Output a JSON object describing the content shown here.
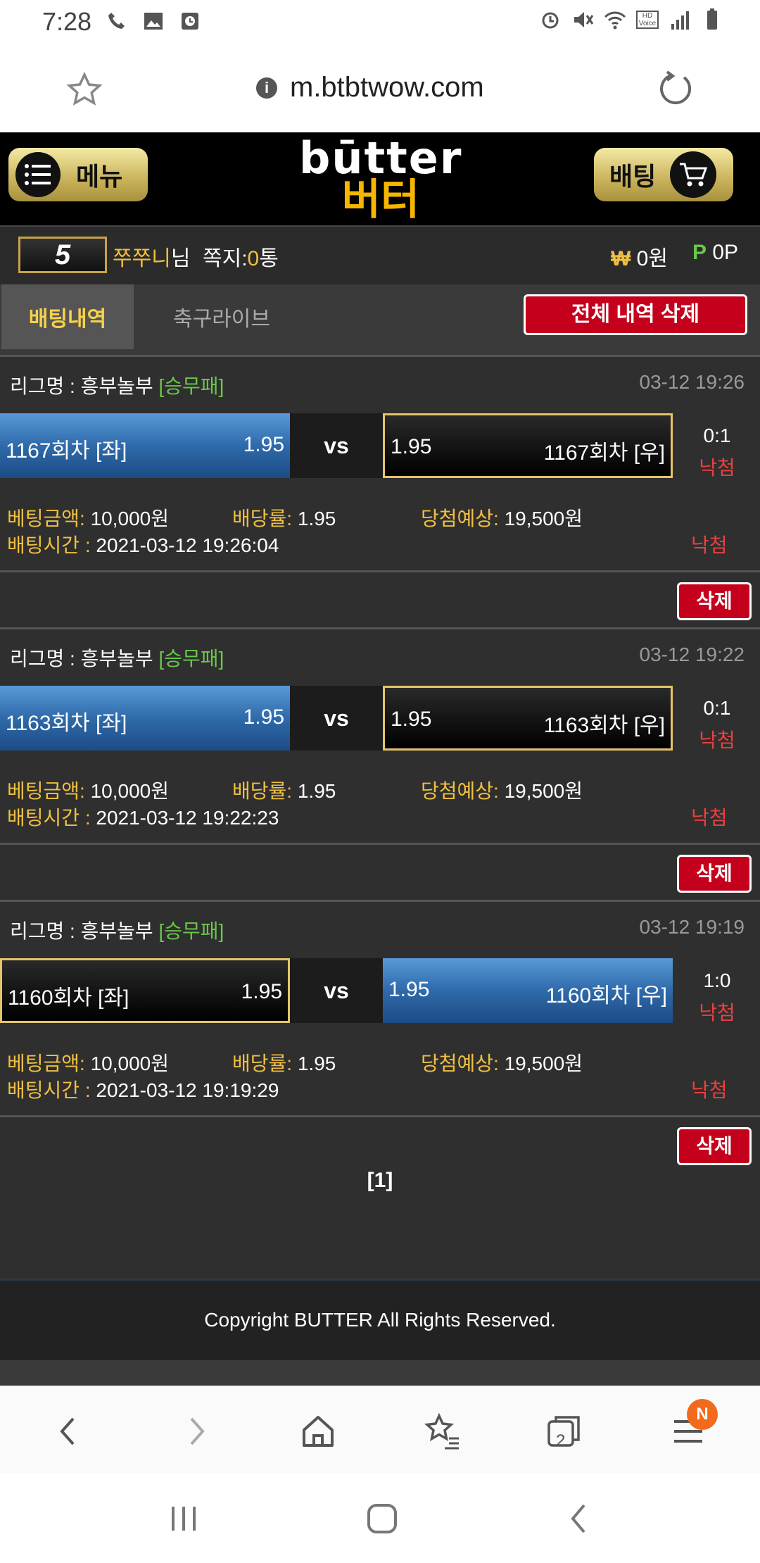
{
  "status": {
    "time": "7:28",
    "hd_voice": "HD Voice"
  },
  "browser": {
    "url": "m.btbtwow.com"
  },
  "header": {
    "menu_label": "메뉴",
    "bet_label": "배팅",
    "logo_en": "būtter",
    "logo_kr": "버터"
  },
  "user": {
    "level": "5",
    "name": "쭈쭈니",
    "suffix": "님",
    "message_label": "쪽지:",
    "message_count": "0",
    "message_unit": "통",
    "money_symbol": "₩",
    "money": "0원",
    "point_symbol": "P",
    "points": "0P"
  },
  "tabs": {
    "active": "배팅내역",
    "inactive": "축구라이브",
    "delete_all": "전체 내역 삭제"
  },
  "bets": [
    {
      "league_label": "리그명 : 흥부놀부",
      "type": "[승무패]",
      "date": "03-12 19:26",
      "left_team": "1167회차 [좌]",
      "left_odds": "1.95",
      "vs": "vs",
      "right_odds": "1.95",
      "right_team": "1167회차 [우]",
      "score": "0:1",
      "score_status": "낙첨",
      "amount_label": "베팅금액:",
      "amount": "10,000원",
      "rate_label": "배당률:",
      "rate": "1.95",
      "expect_label": "당첨예상:",
      "expect": "19,500원",
      "time_label": "배팅시간 :",
      "time": "2021-03-12 19:26:04",
      "status": "낙첨",
      "delete_label": "삭제"
    },
    {
      "league_label": "리그명 : 흥부놀부",
      "type": "[승무패]",
      "date": "03-12 19:22",
      "left_team": "1163회차 [좌]",
      "left_odds": "1.95",
      "vs": "vs",
      "right_odds": "1.95",
      "right_team": "1163회차 [우]",
      "score": "0:1",
      "score_status": "낙첨",
      "amount_label": "베팅금액:",
      "amount": "10,000원",
      "rate_label": "배당률:",
      "rate": "1.95",
      "expect_label": "당첨예상:",
      "expect": "19,500원",
      "time_label": "배팅시간 :",
      "time": "2021-03-12 19:22:23",
      "status": "낙첨",
      "delete_label": "삭제"
    },
    {
      "league_label": "리그명 : 흥부놀부",
      "type": "[승무패]",
      "date": "03-12 19:19",
      "left_team": "1160회차 [좌]",
      "left_odds": "1.95",
      "vs": "vs",
      "right_odds": "1.95",
      "right_team": "1160회차 [우]",
      "score": "1:0",
      "score_status": "낙첨",
      "amount_label": "베팅금액:",
      "amount": "10,000원",
      "rate_label": "배당률:",
      "rate": "1.95",
      "expect_label": "당첨예상:",
      "expect": "19,500원",
      "time_label": "배팅시간 :",
      "time": "2021-03-12 19:19:29",
      "status": "낙첨",
      "delete_label": "삭제"
    }
  ],
  "pager": "[1]",
  "footer": {
    "copyright": "Copyright BUTTER All Rights Reserved."
  },
  "nav": {
    "tab_count": "2",
    "notification": "N"
  },
  "colors": {
    "accent_gold": "#f0c040",
    "danger_red": "#c4001c",
    "win_blue": "#2f6aaa"
  }
}
